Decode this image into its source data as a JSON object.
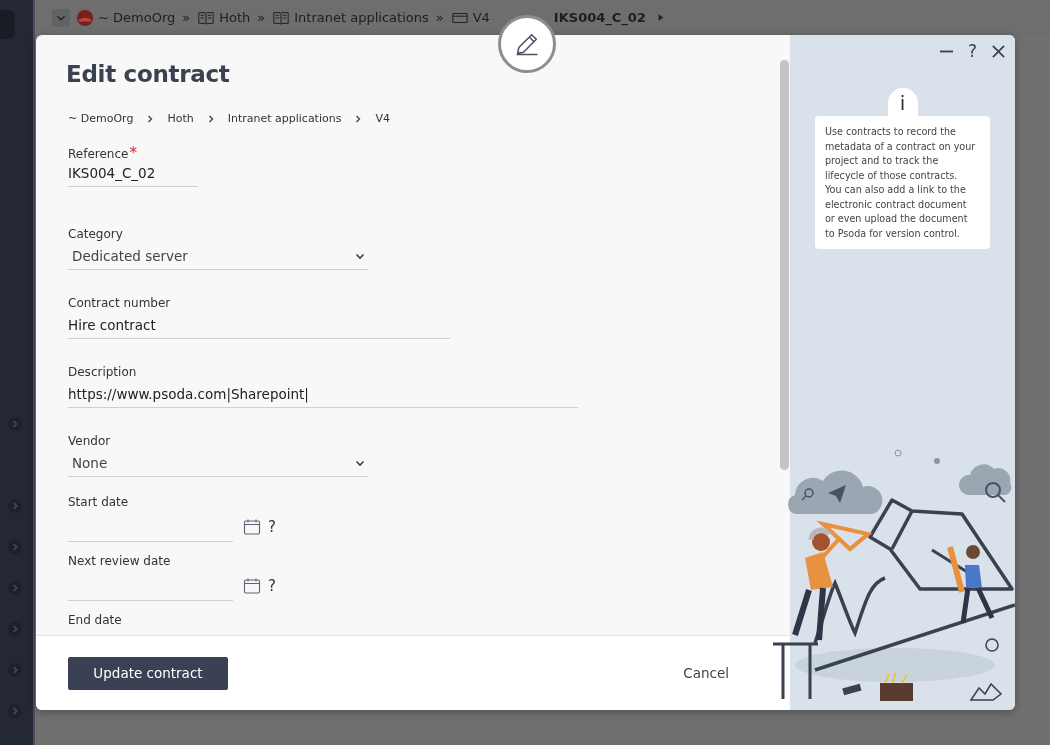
{
  "page_breadcrumb": {
    "separator": "»",
    "items": [
      {
        "kind": "org",
        "label": "~ DemoOrg"
      },
      {
        "kind": "book",
        "label": "Hoth"
      },
      {
        "kind": "book",
        "label": "Intranet applications"
      },
      {
        "kind": "folder",
        "label": "V4"
      },
      {
        "kind": "current",
        "label": "IKS004_C_02"
      }
    ]
  },
  "dialog": {
    "title": "Edit contract",
    "breadcrumb": [
      "~ DemoOrg",
      "Hoth",
      "Intranet applications",
      "V4"
    ],
    "fields": [
      {
        "kind": "text",
        "label": "Reference",
        "required": true,
        "value": "IKS004_C_02"
      },
      {
        "kind": "select",
        "label": "Category",
        "required": false,
        "value": "Dedicated server"
      },
      {
        "kind": "text",
        "label": "Contract number",
        "required": false,
        "value": "Hire contract"
      },
      {
        "kind": "text",
        "label": "Description",
        "required": false,
        "value": "https://www.psoda.com|Sharepoint|"
      },
      {
        "kind": "select",
        "label": "Vendor",
        "required": false,
        "value": "None"
      },
      {
        "kind": "date",
        "label": "Start date",
        "required": false,
        "help": "?"
      },
      {
        "kind": "date",
        "label": "Next review date",
        "required": false,
        "help": "?"
      },
      {
        "kind": "label",
        "label": "End date",
        "required": false
      }
    ],
    "primary_button": "Update contract",
    "cancel_button": "Cancel",
    "help_control": "?",
    "required_mark": "*",
    "info": {
      "icon": "i",
      "text": "Use contracts to record the metadata of a contract on your project and to track the lifecycle of those contracts. You can also add a link to the electronic contract document or even upload the document to Psoda for version control."
    }
  }
}
